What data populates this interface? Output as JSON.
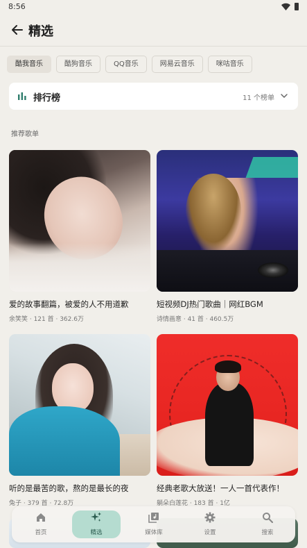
{
  "status_bar": {
    "time": "8:56",
    "icons": [
      "wifi-icon",
      "battery-icon"
    ]
  },
  "app_bar": {
    "back_icon": "arrow-left-icon",
    "title": "精选"
  },
  "sources": [
    {
      "label": "酷我音乐",
      "active": true
    },
    {
      "label": "酷狗音乐",
      "active": false
    },
    {
      "label": "QQ音乐",
      "active": false
    },
    {
      "label": "网易云音乐",
      "active": false
    },
    {
      "label": "咪咕音乐",
      "active": false
    }
  ],
  "ranking": {
    "icon": "bar-chart-icon",
    "label": "排行榜",
    "count": "11 个榜单",
    "chevron": "chevron-down-icon"
  },
  "section": {
    "title": "推荐歌单"
  },
  "playlists": [
    {
      "title": "爱的故事翻篇，被爱的人不用道歉",
      "meta": "余笑笑 · 121 首 · 362.6万"
    },
    {
      "title": "短视频DJ热门歌曲｜网红BGM",
      "meta": "诗情画意 · 41 首 · 460.5万"
    },
    {
      "title": "听的是最苦的歌，熬的是最长的夜",
      "meta": "兔子 · 379 首 · 72.8万"
    },
    {
      "title": "经典老歌大放送！一人一首代表作！",
      "meta": "躺朵白莲花 · 183 首 · 1亿"
    }
  ],
  "bottom_nav": [
    {
      "label": "首页",
      "icon": "home-icon",
      "active": false
    },
    {
      "label": "精选",
      "icon": "sparkle-icon",
      "active": true
    },
    {
      "label": "媒体库",
      "icon": "library-icon",
      "active": false
    },
    {
      "label": "设置",
      "icon": "gear-icon",
      "active": false
    },
    {
      "label": "搜索",
      "icon": "search-icon",
      "active": false
    }
  ],
  "colors": {
    "background": "#f1efea",
    "active_nav": "#b5dcd0",
    "rank_icon": "#2e7d6c"
  }
}
